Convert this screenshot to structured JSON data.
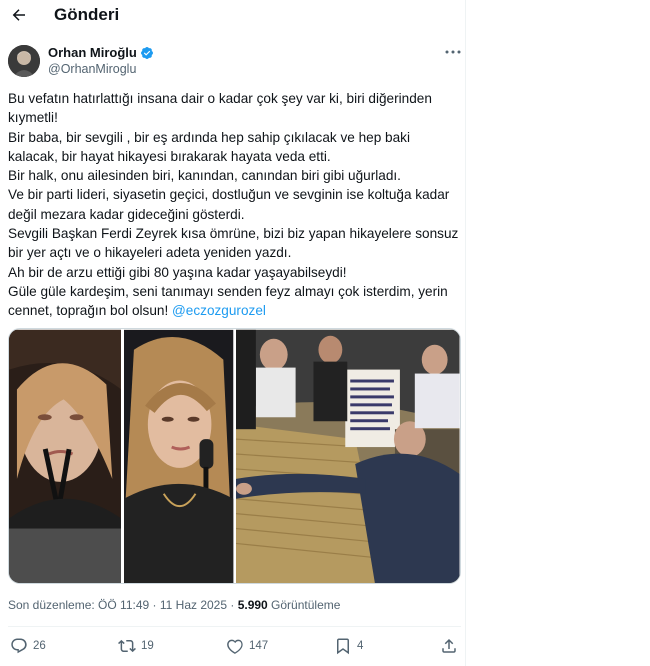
{
  "header": {
    "back_icon": "arrow-left-icon",
    "title": "Gönderi"
  },
  "author": {
    "name": "Orhan Miroğlu",
    "handle": "@OrhanMiroglu",
    "verified_icon": "verified-badge-icon",
    "verified_color": "#1d9bf0"
  },
  "tweet": {
    "text": "Bu vefatın hatırlattığı insana dair o kadar çok şey var ki, biri diğerinden kıymetli!\nBir baba, bir sevgili , bir eş ardında hep sahip çıkılacak ve hep baki kalacak, bir hayat hikayesi bırakarak hayata veda etti.\nBir halk, onu ailesinden biri, kanından, canından biri gibi uğurladı.\nVe bir parti lideri, siyasetin geçici,  dostluğun ve sevginin ise koltuğa kadar değil mezara kadar gideceğini gösterdi.\nSevgili Başkan Ferdi Zeyrek kısa ömrüne, bizi biz yapan hikayelere sonsuz bir yer açtı ve o hikayeleri adeta  yeniden yazdı.\nAh bir de arzu ettiği gibi 80 yaşına kadar yaşayabilseydi!\nGüle güle kardeşim, seni tanımayı senden feyz almayı çok isterdim, yerin cennet, toprağın bol olsun! ",
    "mention": "@eczozgurozel",
    "mention_color": "#1d9bf0"
  },
  "meta": {
    "edited": "Son düzenleme: ÖÖ 11:49 · 11 Haz 2025 · ",
    "views_count": "5.990",
    "views_label": " Görüntüleme"
  },
  "actions": {
    "replies": "26",
    "reposts": "19",
    "likes": "147",
    "bookmarks": "4"
  },
  "colors": {
    "text": "#0f1419",
    "secondary": "#536471",
    "border": "#eff3f4",
    "accent": "#1d9bf0"
  }
}
